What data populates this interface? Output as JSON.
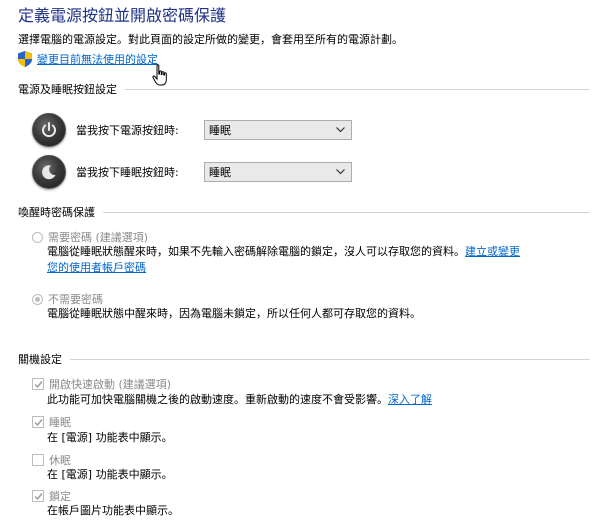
{
  "page": {
    "title": "定義電源按鈕並開啟密碼保護",
    "description": "選擇電腦的電源設定。對此頁面的設定所做的變更，會套用至所有的電源計劃。",
    "change_settings_link": "變更目前無法使用的設定"
  },
  "power_section": {
    "header": "電源及睡眠按鈕設定",
    "power_button": {
      "label": "當我按下電源按鈕時:",
      "value": "睡眠"
    },
    "sleep_button": {
      "label": "當我按下睡眠按鈕時:",
      "value": "睡眠"
    }
  },
  "wake_section": {
    "header": "喚醒時密碼保護",
    "require": {
      "label": "需要密碼 (建議選項)",
      "desc_line1": "電腦從睡眠狀態醒來時，如果不先輸入密碼解除電腦的鎖定，沒人可以存取您的資料。",
      "link_part1": "建立或變更",
      "link_part2": "您的使用者帳戶密碼",
      "checked": false
    },
    "no_require": {
      "label": "不需要密碼",
      "desc": "電腦從睡眠狀態中醒來時，因為電腦未鎖定，所以任何人都可存取您的資料。",
      "checked": true
    }
  },
  "shutdown_section": {
    "header": "關機設定",
    "fast_startup": {
      "label": "開啟快速啟動 (建議選項)",
      "desc": "此功能可加快電腦關機之後的啟動速度。重新啟動的速度不會受影響。",
      "link": "深入了解",
      "checked": true
    },
    "sleep": {
      "label": "睡眠",
      "desc": "在 [電源] 功能表中顯示。",
      "checked": true
    },
    "hibernate": {
      "label": "休眠",
      "desc": "在 [電源] 功能表中顯示。",
      "checked": false
    },
    "lock": {
      "label": "鎖定",
      "desc": "在帳戶圖片功能表中顯示。",
      "checked": true
    }
  }
}
